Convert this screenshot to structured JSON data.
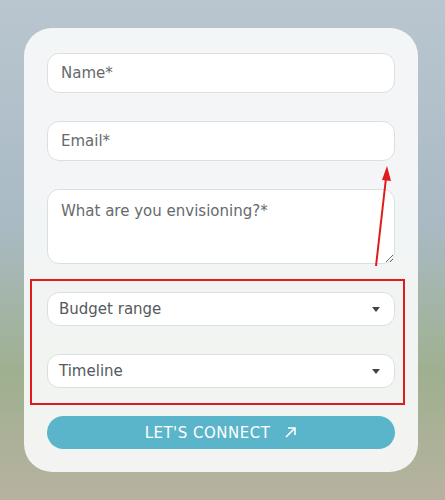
{
  "form": {
    "fields": [
      {
        "kind": "input",
        "placeholder": "Name*"
      },
      {
        "kind": "input",
        "placeholder": "Email*"
      },
      {
        "kind": "textarea",
        "placeholder": "What are you envisioning?*"
      },
      {
        "kind": "select",
        "placeholder": "Budget range"
      },
      {
        "kind": "select",
        "placeholder": "Timeline"
      }
    ],
    "button": {
      "label": "LET'S CONNECT"
    }
  }
}
